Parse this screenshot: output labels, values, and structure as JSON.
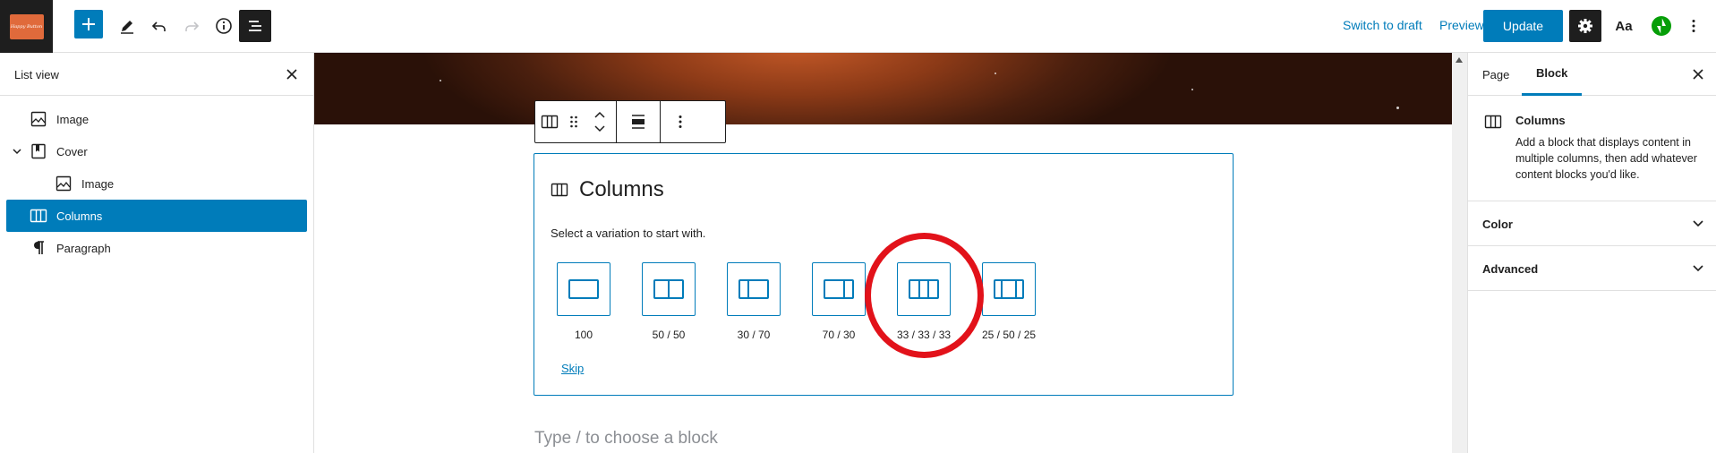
{
  "topbar": {
    "logo_text": "Happy Button",
    "switch_to_draft": "Switch to draft",
    "preview": "Preview",
    "update": "Update",
    "typography": "Aa"
  },
  "listview": {
    "title": "List view",
    "items": [
      {
        "label": "Image"
      },
      {
        "label": "Cover"
      },
      {
        "label": "Image"
      },
      {
        "label": "Columns"
      },
      {
        "label": "Paragraph"
      }
    ]
  },
  "columns_block": {
    "title": "Columns",
    "instructions": "Select a variation to start with.",
    "variations": [
      {
        "label": "100"
      },
      {
        "label": "50 / 50"
      },
      {
        "label": "30 / 70"
      },
      {
        "label": "70 / 30"
      },
      {
        "label": "33 / 33 / 33"
      },
      {
        "label": "25 / 50 / 25"
      }
    ],
    "skip": "Skip"
  },
  "editor": {
    "placeholder": "Type / to choose a block"
  },
  "sidebar": {
    "tabs": [
      {
        "label": "Page"
      },
      {
        "label": "Block"
      }
    ],
    "active_tab": "Block",
    "block_card": {
      "name": "Columns",
      "description": "Add a block that displays content in multiple columns, then add whatever content blocks you'd like."
    },
    "panels": [
      {
        "title": "Color"
      },
      {
        "title": "Advanced"
      }
    ]
  },
  "colors": {
    "accent": "#007cba",
    "annotation": "#e2121a",
    "dark": "#1e1e1e"
  }
}
